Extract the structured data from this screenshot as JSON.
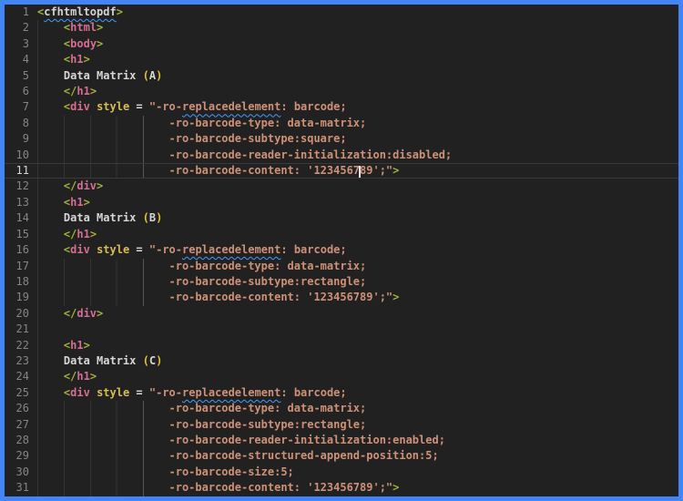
{
  "app": {
    "kind": "code-editor",
    "language": "cfml-html",
    "colors": {
      "focus_border": "#4285f4",
      "editor_background": "#212121",
      "line_number": "#858585",
      "line_number_active": "#d7d7d7",
      "tag_bracket": "#a2b139",
      "tag_name": "#d66d92",
      "unknown_tag": "#d4d4d4",
      "attribute": "#d8bc54",
      "string": "#ce9178",
      "bracket_pair_gold": "#e0c33c",
      "squiggle_info": "#3f9eff",
      "cursor": "#e8e8e8"
    }
  },
  "editor": {
    "cursor": {
      "line": 11,
      "between": "'1234567|89'"
    },
    "lines": [
      {
        "num": "1",
        "current": false,
        "guides": "none",
        "tokens": [
          {
            "t": "<",
            "s": "punct"
          },
          {
            "t": "cfhtmltopdf",
            "s": "tagu sq"
          },
          {
            "t": ">",
            "s": "punct"
          }
        ]
      },
      {
        "num": "2",
        "current": false,
        "guides": "g0",
        "tokens": [
          {
            "t": "    ",
            "s": "plain"
          },
          {
            "t": "<",
            "s": "punct"
          },
          {
            "t": "html",
            "s": "tag"
          },
          {
            "t": ">",
            "s": "punct"
          }
        ]
      },
      {
        "num": "3",
        "current": false,
        "guides": "g0",
        "tokens": [
          {
            "t": "    ",
            "s": "plain"
          },
          {
            "t": "<",
            "s": "punct"
          },
          {
            "t": "body",
            "s": "tag"
          },
          {
            "t": ">",
            "s": "punct"
          }
        ]
      },
      {
        "num": "4",
        "current": false,
        "guides": "g0",
        "tokens": [
          {
            "t": "    ",
            "s": "plain"
          },
          {
            "t": "<",
            "s": "punct"
          },
          {
            "t": "h1",
            "s": "tag"
          },
          {
            "t": ">",
            "s": "punct"
          }
        ]
      },
      {
        "num": "5",
        "current": false,
        "guides": "g0",
        "tokens": [
          {
            "t": "    Data Matrix ",
            "s": "plain"
          },
          {
            "t": "(",
            "s": "paren"
          },
          {
            "t": "A",
            "s": "plain"
          },
          {
            "t": ")",
            "s": "paren"
          }
        ]
      },
      {
        "num": "6",
        "current": false,
        "guides": "g0",
        "tokens": [
          {
            "t": "    ",
            "s": "plain"
          },
          {
            "t": "</",
            "s": "punct"
          },
          {
            "t": "h1",
            "s": "tag"
          },
          {
            "t": ">",
            "s": "punct"
          }
        ]
      },
      {
        "num": "7",
        "current": false,
        "guides": "g0",
        "tokens": [
          {
            "t": "    ",
            "s": "plain"
          },
          {
            "t": "<",
            "s": "punct"
          },
          {
            "t": "div",
            "s": "tag"
          },
          {
            "t": " ",
            "s": "plain"
          },
          {
            "t": "style",
            "s": "attr"
          },
          {
            "t": " = ",
            "s": "plain"
          },
          {
            "t": "\"-ro-",
            "s": "string"
          },
          {
            "t": "replacedelement",
            "s": "string sq"
          },
          {
            "t": ": barcode;",
            "s": "string"
          }
        ]
      },
      {
        "num": "8",
        "current": false,
        "guides": "cont",
        "tokens": [
          {
            "t": "                    ",
            "s": "plain"
          },
          {
            "t": "-ro-barcode-type: data-matrix;",
            "s": "string"
          }
        ]
      },
      {
        "num": "9",
        "current": false,
        "guides": "cont",
        "tokens": [
          {
            "t": "                    ",
            "s": "plain"
          },
          {
            "t": "-ro-barcode-subtype:square;",
            "s": "string"
          }
        ]
      },
      {
        "num": "10",
        "current": false,
        "guides": "cont",
        "tokens": [
          {
            "t": "                    ",
            "s": "plain"
          },
          {
            "t": "-ro-barcode-reader-initialization:disabled;",
            "s": "string"
          }
        ]
      },
      {
        "num": "11",
        "current": true,
        "guides": "cont",
        "tokens": [
          {
            "t": "                    ",
            "s": "plain"
          },
          {
            "t": "-ro-barcode-content: '1234567",
            "s": "string"
          },
          {
            "t": "",
            "s": "caret"
          },
          {
            "t": "89';\"",
            "s": "string"
          },
          {
            "t": ">",
            "s": "punct"
          }
        ]
      },
      {
        "num": "12",
        "current": false,
        "guides": "g0",
        "tokens": [
          {
            "t": "    ",
            "s": "plain"
          },
          {
            "t": "</",
            "s": "punct"
          },
          {
            "t": "div",
            "s": "tag"
          },
          {
            "t": ">",
            "s": "punct"
          }
        ]
      },
      {
        "num": "13",
        "current": false,
        "guides": "g0",
        "tokens": [
          {
            "t": "    ",
            "s": "plain"
          },
          {
            "t": "<",
            "s": "punct"
          },
          {
            "t": "h1",
            "s": "tag"
          },
          {
            "t": ">",
            "s": "punct"
          }
        ]
      },
      {
        "num": "14",
        "current": false,
        "guides": "g0",
        "tokens": [
          {
            "t": "    Data Matrix ",
            "s": "plain"
          },
          {
            "t": "(",
            "s": "paren"
          },
          {
            "t": "B",
            "s": "plain"
          },
          {
            "t": ")",
            "s": "paren"
          }
        ]
      },
      {
        "num": "15",
        "current": false,
        "guides": "g0",
        "tokens": [
          {
            "t": "    ",
            "s": "plain"
          },
          {
            "t": "</",
            "s": "punct"
          },
          {
            "t": "h1",
            "s": "tag"
          },
          {
            "t": ">",
            "s": "punct"
          }
        ]
      },
      {
        "num": "16",
        "current": false,
        "guides": "g0",
        "tokens": [
          {
            "t": "    ",
            "s": "plain"
          },
          {
            "t": "<",
            "s": "punct"
          },
          {
            "t": "div",
            "s": "tag"
          },
          {
            "t": " ",
            "s": "plain"
          },
          {
            "t": "style",
            "s": "attr"
          },
          {
            "t": " = ",
            "s": "plain"
          },
          {
            "t": "\"-ro-",
            "s": "string"
          },
          {
            "t": "replacedelement",
            "s": "string sq"
          },
          {
            "t": ": barcode;",
            "s": "string"
          }
        ]
      },
      {
        "num": "17",
        "current": false,
        "guides": "cont",
        "tokens": [
          {
            "t": "                    ",
            "s": "plain"
          },
          {
            "t": "-ro-barcode-type: data-matrix;",
            "s": "string"
          }
        ]
      },
      {
        "num": "18",
        "current": false,
        "guides": "cont",
        "tokens": [
          {
            "t": "                    ",
            "s": "plain"
          },
          {
            "t": "-ro-barcode-subtype:rectangle;",
            "s": "string"
          }
        ]
      },
      {
        "num": "19",
        "current": false,
        "guides": "cont",
        "tokens": [
          {
            "t": "                    ",
            "s": "plain"
          },
          {
            "t": "-ro-barcode-content: '123456789';\"",
            "s": "string"
          },
          {
            "t": ">",
            "s": "punct"
          }
        ]
      },
      {
        "num": "20",
        "current": false,
        "guides": "g0",
        "tokens": [
          {
            "t": "    ",
            "s": "plain"
          },
          {
            "t": "</",
            "s": "punct"
          },
          {
            "t": "div",
            "s": "tag"
          },
          {
            "t": ">",
            "s": "punct"
          }
        ]
      },
      {
        "num": "21",
        "current": false,
        "guides": "g0",
        "tokens": []
      },
      {
        "num": "22",
        "current": false,
        "guides": "g0",
        "tokens": [
          {
            "t": "    ",
            "s": "plain"
          },
          {
            "t": "<",
            "s": "punct"
          },
          {
            "t": "h1",
            "s": "tag"
          },
          {
            "t": ">",
            "s": "punct"
          }
        ]
      },
      {
        "num": "23",
        "current": false,
        "guides": "g0",
        "tokens": [
          {
            "t": "    Data Matrix ",
            "s": "plain"
          },
          {
            "t": "(",
            "s": "paren"
          },
          {
            "t": "C",
            "s": "plain"
          },
          {
            "t": ")",
            "s": "paren"
          }
        ]
      },
      {
        "num": "24",
        "current": false,
        "guides": "g0",
        "tokens": [
          {
            "t": "    ",
            "s": "plain"
          },
          {
            "t": "</",
            "s": "punct"
          },
          {
            "t": "h1",
            "s": "tag"
          },
          {
            "t": ">",
            "s": "punct"
          }
        ]
      },
      {
        "num": "25",
        "current": false,
        "guides": "g0",
        "tokens": [
          {
            "t": "    ",
            "s": "plain"
          },
          {
            "t": "<",
            "s": "punct"
          },
          {
            "t": "div",
            "s": "tag"
          },
          {
            "t": " ",
            "s": "plain"
          },
          {
            "t": "style",
            "s": "attr"
          },
          {
            "t": " = ",
            "s": "plain"
          },
          {
            "t": "\"-ro-",
            "s": "string"
          },
          {
            "t": "replacedelement",
            "s": "string sq"
          },
          {
            "t": ": barcode;",
            "s": "string"
          }
        ]
      },
      {
        "num": "26",
        "current": false,
        "guides": "cont",
        "tokens": [
          {
            "t": "                    ",
            "s": "plain"
          },
          {
            "t": "-ro-barcode-type: data-matrix;",
            "s": "string"
          }
        ]
      },
      {
        "num": "27",
        "current": false,
        "guides": "cont",
        "tokens": [
          {
            "t": "                    ",
            "s": "plain"
          },
          {
            "t": "-ro-barcode-subtype:rectangle;",
            "s": "string"
          }
        ]
      },
      {
        "num": "28",
        "current": false,
        "guides": "cont",
        "tokens": [
          {
            "t": "                    ",
            "s": "plain"
          },
          {
            "t": "-ro-barcode-reader-initialization:enabled;",
            "s": "string"
          }
        ]
      },
      {
        "num": "29",
        "current": false,
        "guides": "cont",
        "tokens": [
          {
            "t": "                    ",
            "s": "plain"
          },
          {
            "t": "-ro-barcode-structured-append-position:5;",
            "s": "string"
          }
        ]
      },
      {
        "num": "30",
        "current": false,
        "guides": "cont",
        "tokens": [
          {
            "t": "                    ",
            "s": "plain"
          },
          {
            "t": "-ro-barcode-size:5;",
            "s": "string"
          }
        ]
      },
      {
        "num": "31",
        "current": false,
        "guides": "cont",
        "tokens": [
          {
            "t": "                    ",
            "s": "plain"
          },
          {
            "t": "-ro-barcode-content: '123456789';\"",
            "s": "string"
          },
          {
            "t": ">",
            "s": "punct"
          }
        ]
      }
    ]
  }
}
